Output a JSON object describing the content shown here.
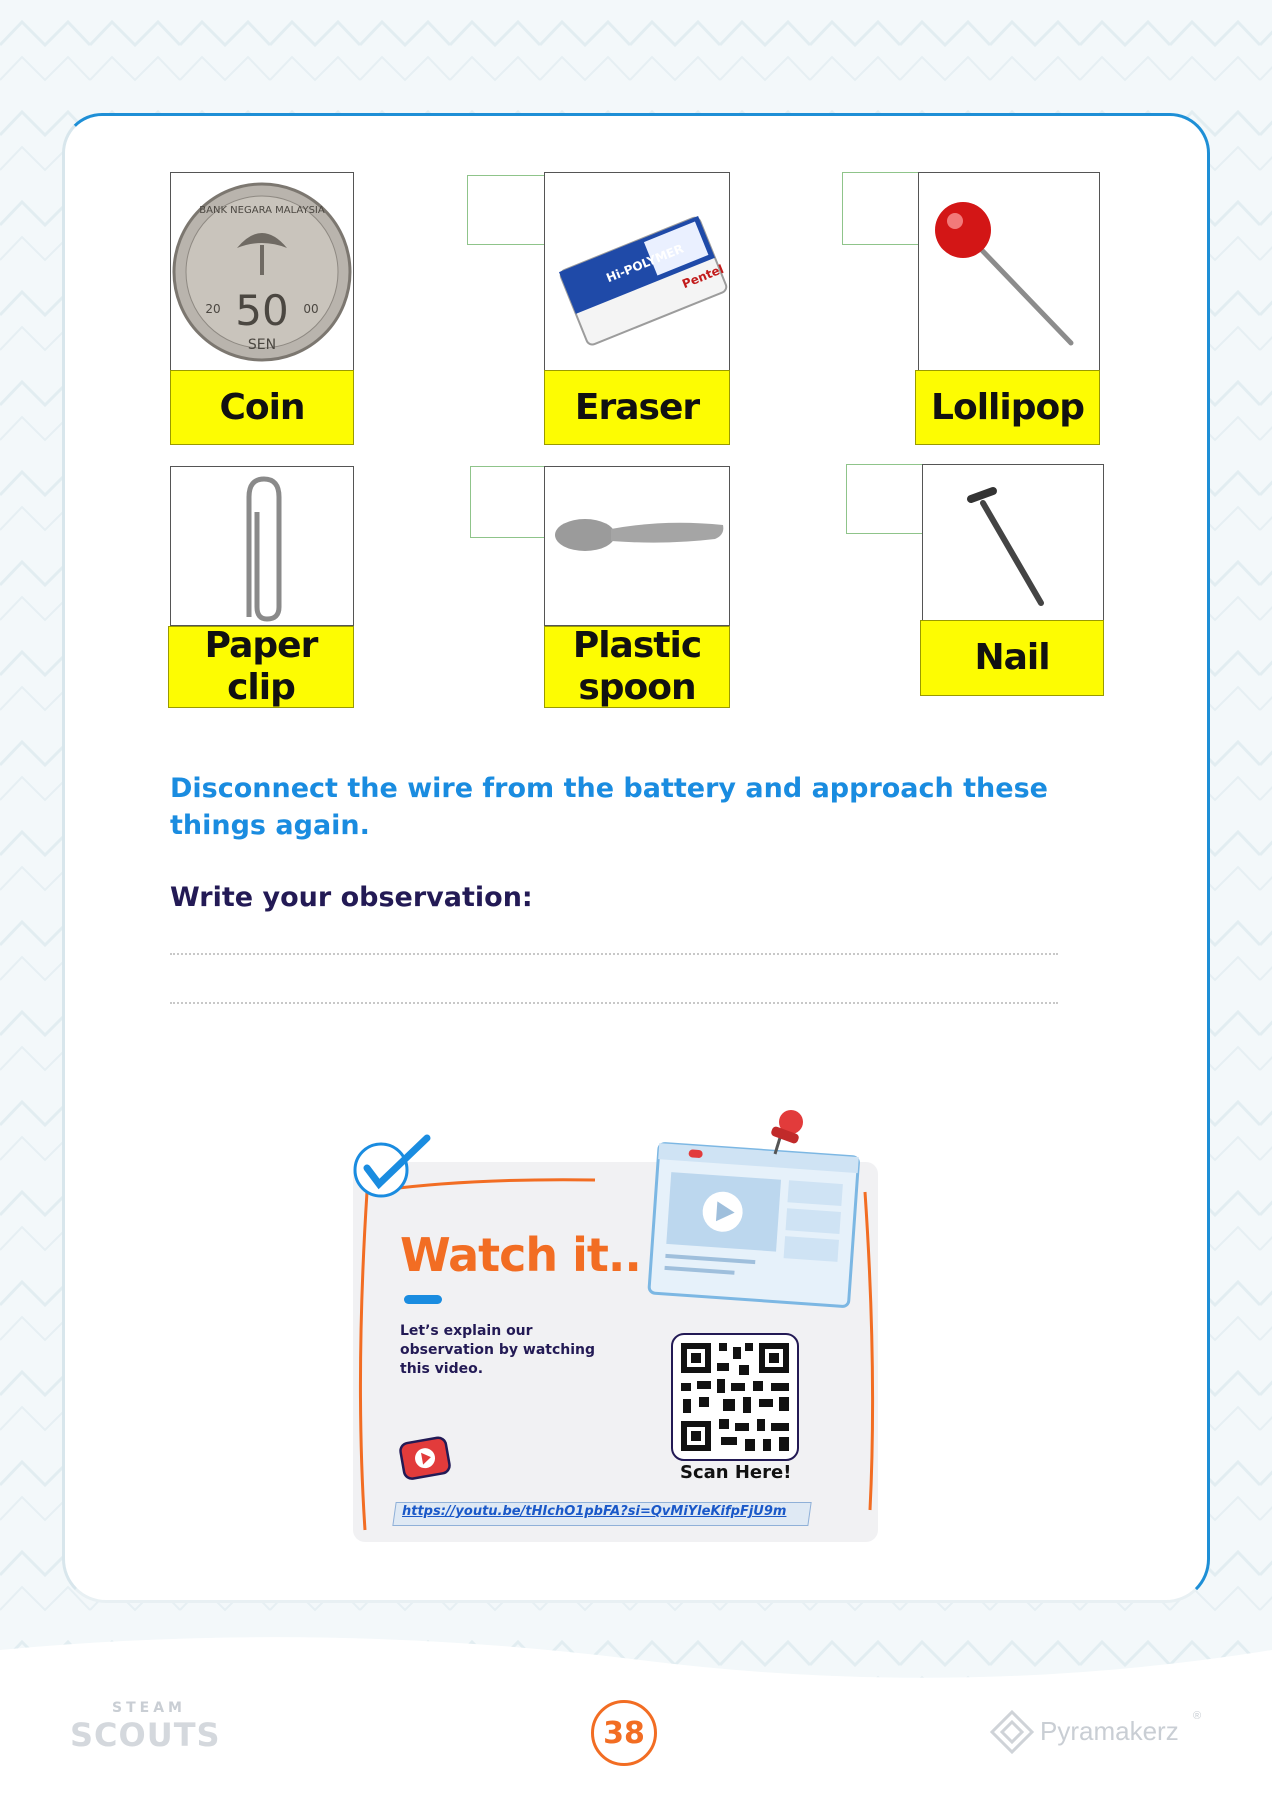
{
  "items": [
    {
      "label": "Coin"
    },
    {
      "label": "Eraser"
    },
    {
      "label": "Lollipop"
    },
    {
      "label": "Paper\nclip"
    },
    {
      "label": "Plastic\nspoon"
    },
    {
      "label": "Nail"
    }
  ],
  "instruction": "Disconnect the wire from the battery and approach these things again.",
  "observation_prompt": "Write your observation:",
  "watch": {
    "title": "Watch it..",
    "description": "Let’s explain our observation by watching this video.",
    "scan_label": "Scan Here!",
    "link": "https://youtu.be/tHIchO1pbFA?si=QvMiYleKifpFjU9m"
  },
  "coin": {
    "line1": "BANK NEGARA MALAYSIA",
    "value": "50",
    "unit": "SEN",
    "year_left": "20",
    "year_right": "00"
  },
  "eraser": {
    "brand": "Hi-POLYMER",
    "maker": "Pentel"
  },
  "footer": {
    "page_number": "38",
    "left_logo_top": "STEAM",
    "left_logo_bottom": "SCOUTS",
    "right_logo": "Pyramakerz",
    "right_logo_mark": "®"
  },
  "colors": {
    "accent_blue": "#1a8ce0",
    "accent_orange": "#f26d23",
    "label_yellow": "#fdfc02",
    "navy": "#231a55"
  }
}
